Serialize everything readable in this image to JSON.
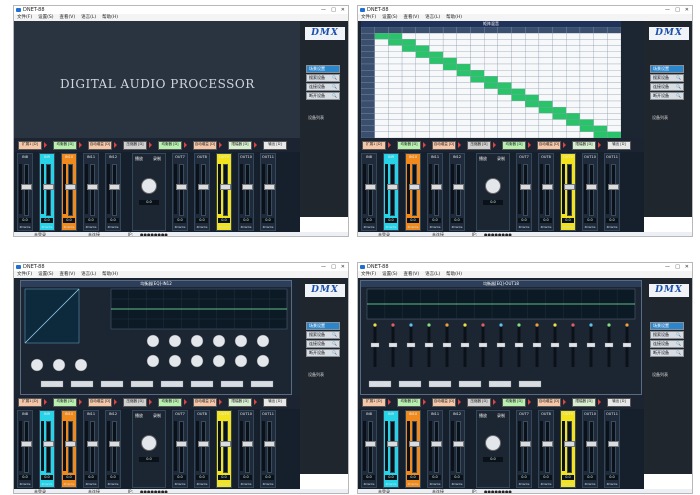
{
  "app": {
    "title": "DNET-88",
    "menu": [
      "文件(F)",
      "设置(S)",
      "查看(V)",
      "语言(L)",
      "帮助(H)"
    ],
    "window_controls": [
      "—",
      "□",
      "✕"
    ]
  },
  "side": {
    "logo": "DMX",
    "buttons": [
      {
        "label": "场景设置",
        "icon": "",
        "active": true
      },
      {
        "label": "搜索设备",
        "icon": "🔍",
        "active": false
      },
      {
        "label": "连接设备",
        "icon": "🔍",
        "active": false
      },
      {
        "label": "断开设备",
        "icon": "🔍",
        "active": false
      }
    ],
    "device_list": "设备列表"
  },
  "main": {
    "banner": "DIGITAL AUDIO PROCESSOR",
    "matrix_title": "矩阵混音",
    "eq1_title": "均衡器[EQ]-IN12",
    "eq2_title": "均衡器[EQ]-OUT18"
  },
  "path_buttons": [
    "扩展1\n[D]",
    "均衡器\n[D]",
    "自动增益\n[D]",
    "压缩器\n[D]",
    "均衡器\n[D]",
    "自动增益\n[D]",
    "限幅器\n[D]",
    "输出\n[D]"
  ],
  "path_colors": [
    "#f5c7a8",
    "#b8f0b0",
    "#f5c7a8",
    "#d0d0d0",
    "#b8f0b0",
    "#f5c7a8",
    "#d8eed0",
    "#e8e8e8"
  ],
  "mixer": {
    "left_channels": [
      {
        "label": "IN8",
        "value": "0.0",
        "brand": "4Dante",
        "color": "normal"
      },
      {
        "label": "IN9",
        "value": "0.0",
        "brand": "4Dante",
        "color": "cyan"
      },
      {
        "label": "IN10",
        "value": "0.0",
        "brand": "4Dante",
        "color": "orange"
      },
      {
        "label": "IN11",
        "value": "0.0",
        "brand": "4Dante",
        "color": "normal"
      },
      {
        "label": "IN12",
        "value": "0.0",
        "brand": "4Dante",
        "color": "normal"
      }
    ],
    "master_label": "播放",
    "master_label2": "录制",
    "master_value": "0.0",
    "right_channels": [
      {
        "label": "OUT7",
        "value": "0.0",
        "brand": "4Dante",
        "color": "normal"
      },
      {
        "label": "OUT8",
        "value": "0.0",
        "brand": "4Dante",
        "color": "normal"
      },
      {
        "label": "OUT9",
        "value": "0.0",
        "brand": "4Dante",
        "color": "yellow"
      },
      {
        "label": "OUT10",
        "value": "0.0",
        "brand": "4Dante",
        "color": "normal"
      },
      {
        "label": "OUT11",
        "value": "0.0",
        "brand": "4Dante",
        "color": "normal"
      }
    ]
  },
  "status": {
    "left": "未登录",
    "middle": "未连接",
    "ip_label": "IP:",
    "password": "●●●●●●●●"
  }
}
